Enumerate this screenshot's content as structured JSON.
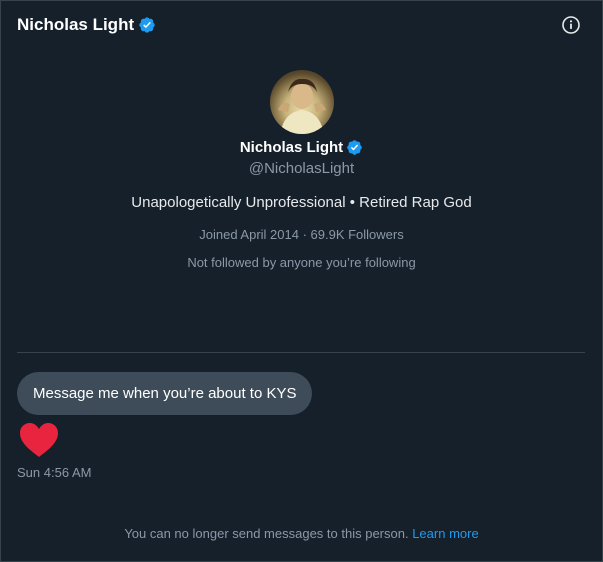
{
  "header": {
    "name": "Nicholas Light"
  },
  "profile": {
    "name": "Nicholas Light",
    "handle": "@NicholasLight",
    "bio": "Unapologetically Unprofessional • Retired Rap God",
    "meta": "Joined April 2014 · 69.9K Followers",
    "mutual": "Not followed by anyone you’re following"
  },
  "conversation": {
    "message": "Message me when you’re about to KYS",
    "reaction_icon": "heart-icon",
    "timestamp": "Sun 4:56 AM"
  },
  "footer": {
    "notice": "You can no longer send messages to this person.",
    "link": "Learn more"
  },
  "colors": {
    "background": "#15202b",
    "bubble": "#3e4c59",
    "accent": "#1d9bf0",
    "heart": "#f91880",
    "muted": "#8b98a5"
  }
}
